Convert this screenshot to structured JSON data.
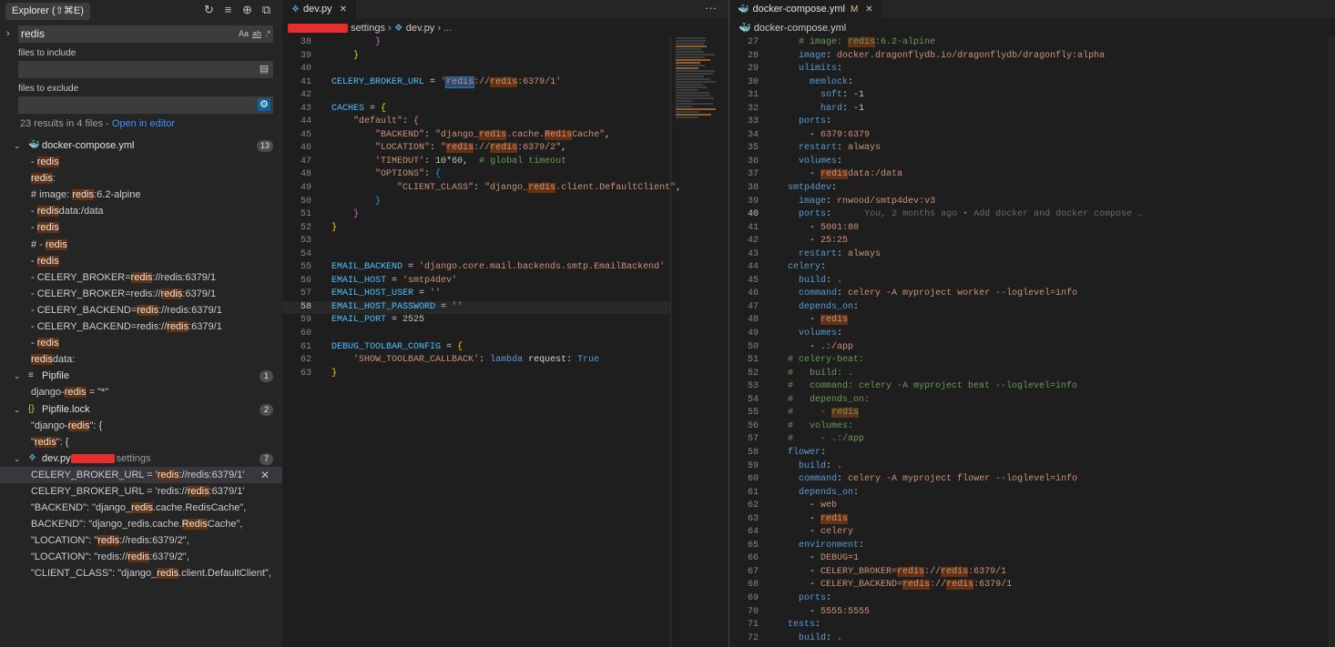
{
  "sidebar": {
    "title": "Explorer (⇧⌘E)",
    "search_value": "redis",
    "search_opts": [
      "Aa",
      "ab",
      ".*"
    ],
    "include_label": "files to include",
    "exclude_label": "files to exclude",
    "summary": "23 results in 4 files - ",
    "open_in_editor": "Open in editor",
    "files": [
      {
        "name": "docker-compose.yml",
        "icon": "whale-icon",
        "color": "#e2426c",
        "count": "13",
        "matches": [
          [
            "- ",
            "redis",
            ""
          ],
          [
            "",
            "redis",
            ":"
          ],
          [
            "# image: ",
            "redis",
            ":6.2-alpine"
          ],
          [
            "- ",
            "redis",
            "data:/data"
          ],
          [
            "- ",
            "redis",
            ""
          ],
          [
            "#    - ",
            "redis",
            ""
          ],
          [
            "- ",
            "redis",
            ""
          ],
          [
            "- CELERY_BROKER=",
            "redis",
            "://redis:6379/1"
          ],
          [
            "- CELERY_BROKER=redis://",
            "redis",
            ":6379/1"
          ],
          [
            "- CELERY_BACKEND=",
            "redis",
            "://redis:6379/1"
          ],
          [
            "- CELERY_BACKEND=redis://",
            "redis",
            ":6379/1"
          ],
          [
            "- ",
            "redis",
            ""
          ],
          [
            "",
            "redis",
            "data:"
          ]
        ]
      },
      {
        "name": "Pipfile",
        "icon": "lines-icon",
        "color": "#c5c5c5",
        "count": "1",
        "matches": [
          [
            "django-",
            "redis",
            " = \"*\""
          ]
        ]
      },
      {
        "name": "Pipfile.lock",
        "icon": "braces-icon",
        "color": "#cbcb41",
        "count": "2",
        "matches": [
          [
            "\"django-",
            "redis",
            "\": {"
          ],
          [
            "\"",
            "redis",
            "\": {"
          ]
        ]
      },
      {
        "name": "dev.py",
        "dir": "settings",
        "icon": "python-icon",
        "color": "#519aba",
        "count": "7",
        "matches": [
          [
            "CELERY_BROKER_URL = '",
            "redis",
            "://redis:6379/1'"
          ],
          [
            "CELERY_BROKER_URL = 'redis://",
            "redis",
            ":6379/1'"
          ],
          [
            "\"BACKEND\": \"django_",
            "redis",
            ".cache.RedisCache\","
          ],
          [
            "BACKEND\": \"django_redis.cache.",
            "Redis",
            "Cache\","
          ],
          [
            "\"LOCATION\": \"",
            "redis",
            "://redis:6379/2\","
          ],
          [
            "\"LOCATION\": \"redis://",
            "redis",
            ":6379/2\","
          ],
          [
            "\"CLIENT_CLASS\": \"django_",
            "redis",
            ".client.DefaultClient\","
          ]
        ]
      }
    ]
  },
  "editor1": {
    "tab_label": "dev.py",
    "breadcrumb": [
      "settings",
      "dev.py",
      "..."
    ],
    "more_label": "···"
  },
  "editor2": {
    "tab_label": "docker-compose.yml",
    "tab_status": "M",
    "breadcrumb": "docker-compose.yml",
    "blame": "You, 2 months ago • Add docker and docker compose …"
  },
  "colors": {
    "accent": "#3794ff",
    "match_bg": "#613214",
    "selection": "#264f78"
  }
}
